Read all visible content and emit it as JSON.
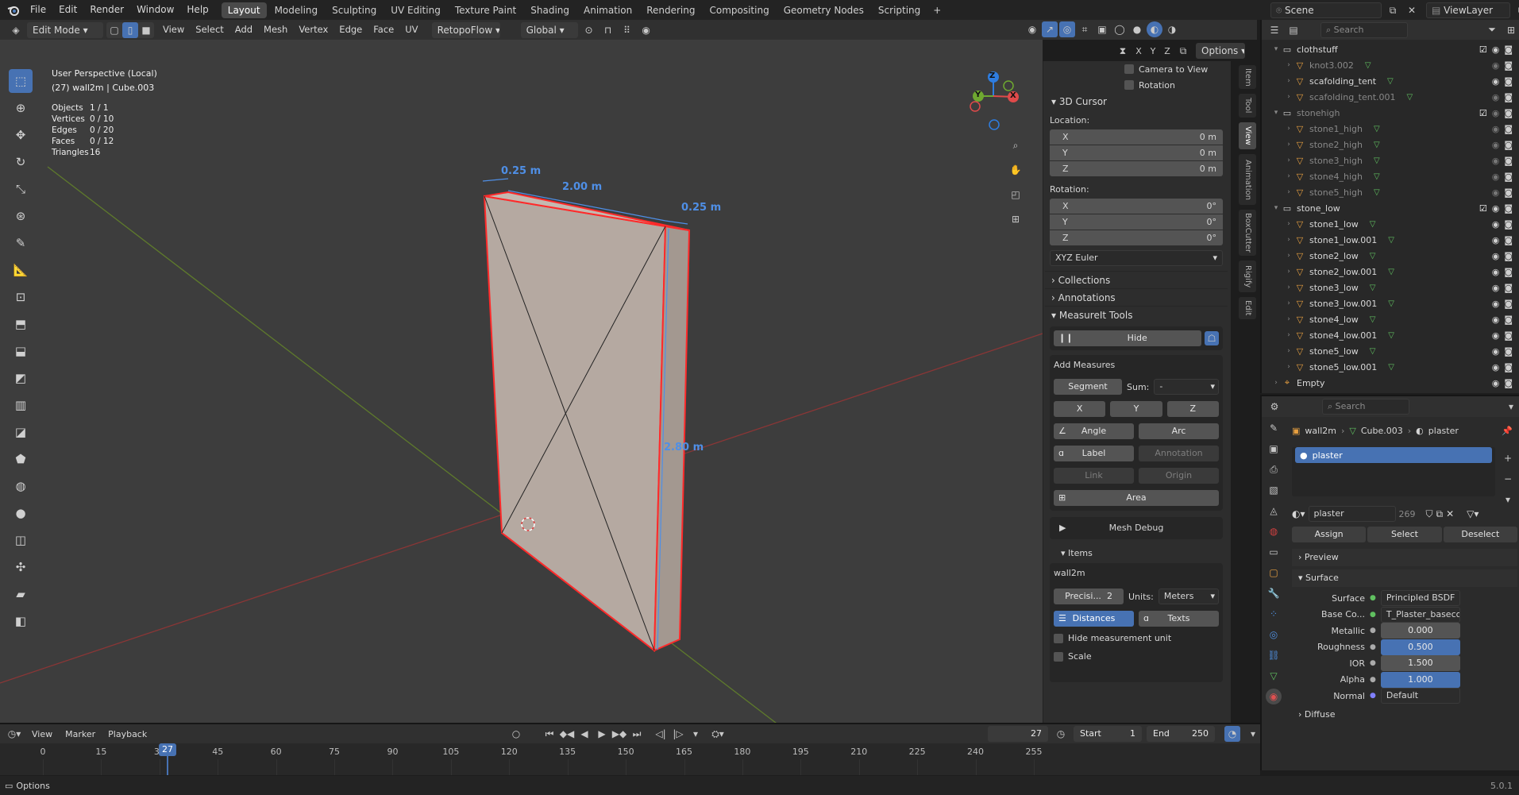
{
  "colors": {
    "accent": "#4772b3",
    "bg": "#1d1d1d",
    "viewport": "#3d3d3d",
    "selection_edge": "#ff2020",
    "measure": "#4f8fe6"
  },
  "topbar": {
    "menus": [
      "File",
      "Edit",
      "Render",
      "Window",
      "Help"
    ],
    "workspaces": [
      "Layout",
      "Modeling",
      "Sculpting",
      "UV Editing",
      "Texture Paint",
      "Shading",
      "Animation",
      "Rendering",
      "Compositing",
      "Geometry Nodes",
      "Scripting"
    ],
    "active_workspace": "Layout",
    "add_tab": "+",
    "scene": "Scene",
    "view_layer": "ViewLayer"
  },
  "header3d": {
    "mode": "Edit Mode",
    "menus": [
      "View",
      "Select",
      "Add",
      "Mesh",
      "Vertex",
      "Edge",
      "Face",
      "UV"
    ],
    "retopo": "RetopoFlow",
    "orientation": "Global",
    "options": "Options",
    "axes": [
      "X",
      "Y",
      "Z"
    ]
  },
  "overlay_info": {
    "perspective": "User Perspective (Local)",
    "object": "(27) wall2m | Cube.003",
    "stats": [
      {
        "label": "Objects",
        "value": "1 / 1"
      },
      {
        "label": "Vertices",
        "value": "0 / 10"
      },
      {
        "label": "Edges",
        "value": "0 / 20"
      },
      {
        "label": "Faces",
        "value": "0 / 12"
      },
      {
        "label": "Triangles",
        "value": "16"
      }
    ]
  },
  "measures": {
    "top_left": "0.25 m",
    "top": "2.00 m",
    "top_right": "0.25 m",
    "height": "2.80 m"
  },
  "gizmo": {
    "x": "X",
    "y": "Y",
    "z": "Z"
  },
  "npanel": {
    "tabs": [
      "Item",
      "Tool",
      "View",
      "Animation",
      "BoxCutter",
      "Rigify",
      "Edit"
    ],
    "camera_to_view": "Camera to View",
    "rotation_lock": "Rotation",
    "cursor_title": "3D Cursor",
    "location_label": "Location:",
    "location": [
      {
        "axis": "X",
        "value": "0 m"
      },
      {
        "axis": "Y",
        "value": "0 m"
      },
      {
        "axis": "Z",
        "value": "0 m"
      }
    ],
    "rotation_label": "Rotation:",
    "rotation": [
      {
        "axis": "X",
        "value": "0°"
      },
      {
        "axis": "Y",
        "value": "0°"
      },
      {
        "axis": "Z",
        "value": "0°"
      }
    ],
    "rotation_mode": "XYZ Euler",
    "collections": "Collections",
    "annotations": "Annotations",
    "measureit_title": "MeasureIt Tools",
    "hide": "Hide",
    "add_measures": "Add Measures",
    "segment": "Segment",
    "sum_label": "Sum:",
    "sum_value": "-",
    "x": "X",
    "y": "Y",
    "z": "Z",
    "angle": "Angle",
    "arc": "Arc",
    "label": "Label",
    "annotation": "Annotation",
    "link": "Link",
    "origin": "Origin",
    "area": "Area",
    "mesh_debug": "Mesh Debug",
    "items_title": "Items",
    "item_name": "wall2m",
    "precision_label": "Precisi...",
    "precision_value": "2",
    "units_label": "Units:",
    "units_value": "Meters",
    "distances": "Distances",
    "texts": "Texts",
    "hide_unit": "Hide measurement unit",
    "scale": "Scale"
  },
  "outliner": {
    "search_placeholder": "Search",
    "rows": [
      {
        "name": "clothstuff",
        "level": 0,
        "type": "collection",
        "dim": false
      },
      {
        "name": "knot3.002",
        "level": 1,
        "type": "mesh",
        "dim": true
      },
      {
        "name": "scafolding_tent",
        "level": 1,
        "type": "mesh",
        "dim": false
      },
      {
        "name": "scafolding_tent.001",
        "level": 1,
        "type": "mesh",
        "dim": true
      },
      {
        "name": "stonehigh",
        "level": 0,
        "type": "collection",
        "dim": true
      },
      {
        "name": "stone1_high",
        "level": 1,
        "type": "mesh",
        "dim": true
      },
      {
        "name": "stone2_high",
        "level": 1,
        "type": "mesh",
        "dim": true
      },
      {
        "name": "stone3_high",
        "level": 1,
        "type": "mesh",
        "dim": true
      },
      {
        "name": "stone4_high",
        "level": 1,
        "type": "mesh",
        "dim": true
      },
      {
        "name": "stone5_high",
        "level": 1,
        "type": "mesh",
        "dim": true
      },
      {
        "name": "stone_low",
        "level": 0,
        "type": "collection",
        "dim": false
      },
      {
        "name": "stone1_low",
        "level": 1,
        "type": "mesh",
        "dim": false
      },
      {
        "name": "stone1_low.001",
        "level": 1,
        "type": "mesh",
        "dim": false
      },
      {
        "name": "stone2_low",
        "level": 1,
        "type": "mesh",
        "dim": false
      },
      {
        "name": "stone2_low.001",
        "level": 1,
        "type": "mesh",
        "dim": false
      },
      {
        "name": "stone3_low",
        "level": 1,
        "type": "mesh",
        "dim": false
      },
      {
        "name": "stone3_low.001",
        "level": 1,
        "type": "mesh",
        "dim": false
      },
      {
        "name": "stone4_low",
        "level": 1,
        "type": "mesh",
        "dim": false
      },
      {
        "name": "stone4_low.001",
        "level": 1,
        "type": "mesh",
        "dim": false
      },
      {
        "name": "stone5_low",
        "level": 1,
        "type": "mesh",
        "dim": false
      },
      {
        "name": "stone5_low.001",
        "level": 1,
        "type": "mesh",
        "dim": false
      },
      {
        "name": "Empty",
        "level": 0,
        "type": "empty",
        "dim": false
      }
    ]
  },
  "properties": {
    "search_placeholder": "Search",
    "breadcrumb": [
      "wall2m",
      "Cube.003",
      "plaster"
    ],
    "slot": "plaster",
    "material": "plaster",
    "users": "269",
    "assign": "Assign",
    "select": "Select",
    "deselect": "Deselect",
    "preview": "Preview",
    "surface_section": "Surface",
    "fields": [
      {
        "label": "Surface",
        "value": "Principled BSDF",
        "kind": "link"
      },
      {
        "label": "Base Co...",
        "value": "T_Plaster_basecolor....",
        "kind": "link"
      },
      {
        "label": "Metallic",
        "value": "0.000",
        "kind": "num"
      },
      {
        "label": "Roughness",
        "value": "0.500",
        "kind": "numblue"
      },
      {
        "label": "IOR",
        "value": "1.500",
        "kind": "num"
      },
      {
        "label": "Alpha",
        "value": "1.000",
        "kind": "numblue"
      },
      {
        "label": "Normal",
        "value": "Default",
        "kind": "link"
      }
    ],
    "diffuse": "Diffuse"
  },
  "timeline": {
    "menus": [
      "View",
      "Marker",
      "Playback"
    ],
    "current_frame": "27",
    "start_label": "Start",
    "start": "1",
    "end_label": "End",
    "end": "250",
    "ticks": [
      "0",
      "15",
      "30",
      "45",
      "60",
      "75",
      "90",
      "105",
      "120",
      "135",
      "150",
      "165",
      "180",
      "195",
      "210",
      "225",
      "240",
      "255"
    ],
    "playhead": "27"
  },
  "statusbar": {
    "left": "Options",
    "version": "5.0.1"
  }
}
